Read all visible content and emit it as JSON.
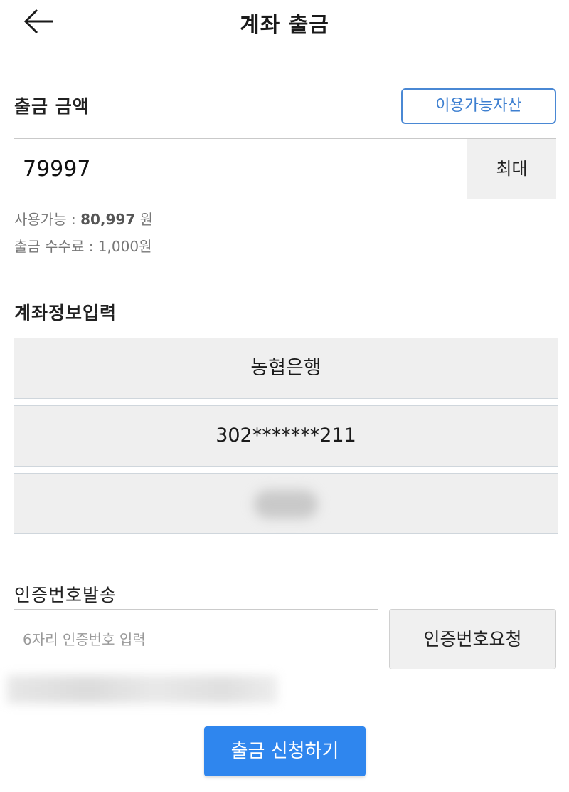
{
  "header": {
    "title": "계좌 출금",
    "back_icon": "arrow-left-icon"
  },
  "amount": {
    "label": "출금 금액",
    "assets_button": "이용가능자산",
    "value": "79997",
    "max_button": "최대",
    "available_prefix": "사용가능 : ",
    "available_amount": "80,997",
    "available_suffix": " 원",
    "fee": "출금 수수료 : 1,000원"
  },
  "account": {
    "label": "계좌정보입력",
    "bank": "농협은행",
    "number": "302*******211"
  },
  "verify": {
    "label": "인증번호발송",
    "placeholder": "6자리 인증번호 입력",
    "request_button": "인증번호요청"
  },
  "submit": {
    "label": "출금 신청하기"
  },
  "colors": {
    "accent": "#2f86ee",
    "assets_border": "#4a88d4",
    "field_bg": "#efefef"
  }
}
